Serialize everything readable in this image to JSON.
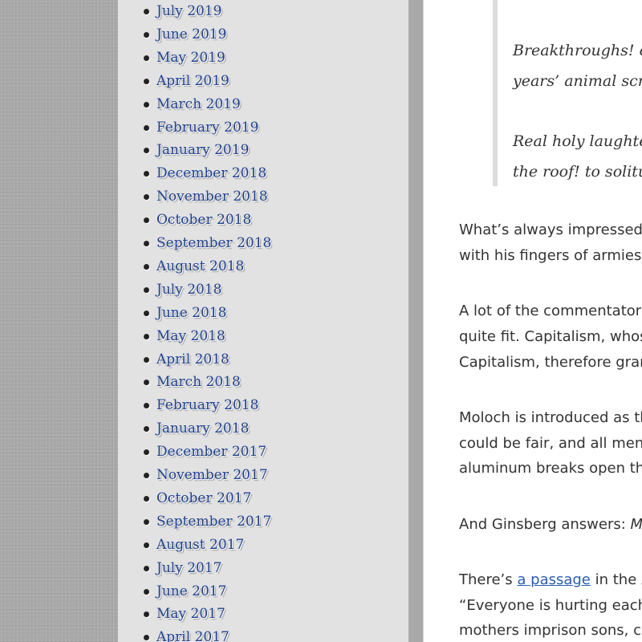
{
  "sidebar": {
    "archive": [
      "July 2019",
      "June 2019",
      "May 2019",
      "April 2019",
      "March 2019",
      "February 2019",
      "January 2019",
      "December 2018",
      "November 2018",
      "October 2018",
      "September 2018",
      "August 2018",
      "July 2018",
      "June 2018",
      "May 2018",
      "April 2018",
      "March 2018",
      "February 2018",
      "January 2018",
      "December 2017",
      "November 2017",
      "October 2017",
      "September 2017",
      "August 2017",
      "July 2017",
      "June 2017",
      "May 2017",
      "April 2017"
    ]
  },
  "article": {
    "quote": {
      "line1": "Breakthroughs! ov",
      "line2": "years’ animal screa",
      "line3": "Real holy laughter",
      "line4": "the roof! to solitud"
    },
    "p1": {
      "line1": "What’s always impressed",
      "line2": "with his fingers of armies"
    },
    "p2": {
      "line1": "A lot of the commentators",
      "line2": "quite fit. Capitalism, whos",
      "line3": "Capitalism, therefore gran"
    },
    "p3": {
      "line1": "Moloch is introduced as th",
      "line2": "could be fair, and all men",
      "line3": "aluminum breaks open th"
    },
    "p4": {
      "line1_prefix": "And Ginsberg answers: ",
      "line1_italic": "Mo"
    },
    "p5": {
      "line1_prefix": "There’s ",
      "link_text": "a passage",
      "line1_mid": " in the ",
      "line1_italic": "P",
      "line2": "“Everyone is hurting each",
      "line3": "mothers imprison sons, cl"
    }
  }
}
